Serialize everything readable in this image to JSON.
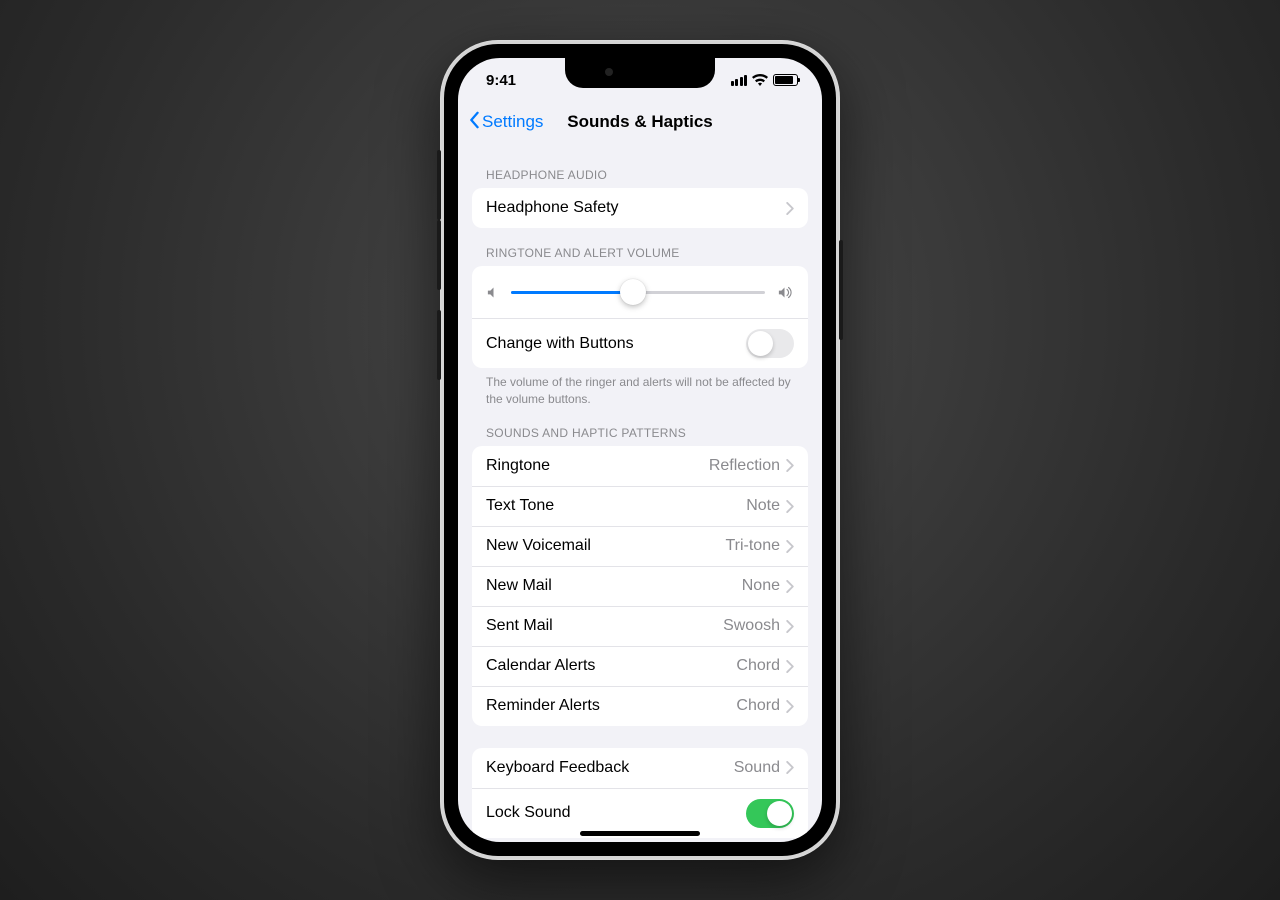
{
  "status": {
    "time": "9:41"
  },
  "nav": {
    "back": "Settings",
    "title": "Sounds & Haptics"
  },
  "sections": {
    "headphone": {
      "header": "Headphone Audio",
      "safety": "Headphone Safety"
    },
    "volume": {
      "header": "Ringtone and Alert Volume",
      "slider_pct": 48,
      "change_with_buttons": "Change with Buttons",
      "change_on": false,
      "footer": "The volume of the ringer and alerts will not be affected by the volume buttons."
    },
    "patterns": {
      "header": "Sounds and Haptic Patterns",
      "items": [
        {
          "label": "Ringtone",
          "value": "Reflection"
        },
        {
          "label": "Text Tone",
          "value": "Note"
        },
        {
          "label": "New Voicemail",
          "value": "Tri-tone"
        },
        {
          "label": "New Mail",
          "value": "None"
        },
        {
          "label": "Sent Mail",
          "value": "Swoosh"
        },
        {
          "label": "Calendar Alerts",
          "value": "Chord"
        },
        {
          "label": "Reminder Alerts",
          "value": "Chord"
        }
      ]
    },
    "misc": {
      "keyboard_feedback": {
        "label": "Keyboard Feedback",
        "value": "Sound"
      },
      "lock_sound": {
        "label": "Lock Sound",
        "on": true
      }
    }
  }
}
